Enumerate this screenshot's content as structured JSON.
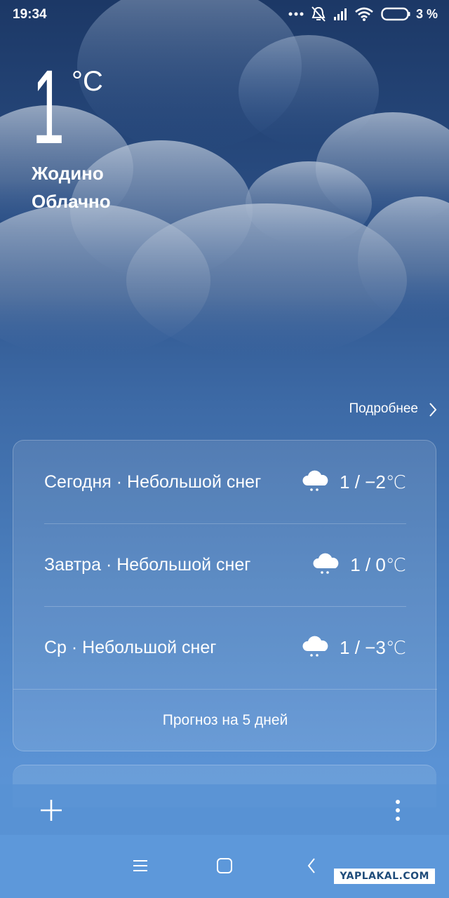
{
  "status_bar": {
    "time": "19:34",
    "icons": [
      "more-dots-icon",
      "muted-bell-icon",
      "signal-icon",
      "wifi-icon",
      "battery-icon"
    ],
    "battery_percent": "3 %"
  },
  "current": {
    "temperature": "1",
    "unit": "°C",
    "city": "Жодино",
    "condition": "Облачно"
  },
  "details_link": "Подробнее",
  "forecast": {
    "rows": [
      {
        "label": "Сегодня · Небольшой снег",
        "icon": "light-snow-cloud-icon",
        "range": "1 / −2℃"
      },
      {
        "label": "Завтра · Небольшой снег",
        "icon": "light-snow-cloud-icon",
        "range": "1 / 0℃"
      },
      {
        "label": "Ср · Небольшой снег",
        "icon": "light-snow-cloud-icon",
        "range": "1 / −3℃"
      }
    ],
    "five_day_button": "Прогноз на 5 дней"
  },
  "toolbar": {
    "add_icon": "plus-icon",
    "menu_icon": "vertical-dots-icon"
  },
  "nav_bar": {
    "icons": [
      "menu-lines-icon",
      "home-square-icon",
      "back-chevron-icon"
    ]
  },
  "watermark": "YAPLAKAL.COM",
  "colors": {
    "sky_top": "#1c3866",
    "sky_bottom": "#5d98da",
    "cloud": "#a8b8cf"
  }
}
